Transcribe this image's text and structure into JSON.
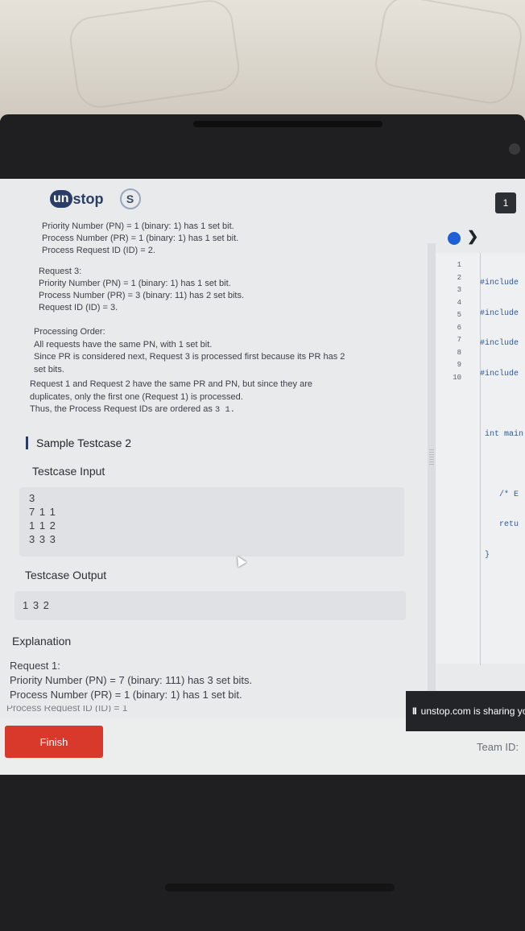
{
  "header": {
    "logo_un": "un",
    "logo_stop": "stop",
    "badge_glyph": "S",
    "question_number": "1"
  },
  "problem": {
    "req2_lines": [
      "Priority Number (PN) = 1 (binary: 1) has 1 set bit.",
      "Process Number (PR) = 1 (binary: 1) has 1 set bit.",
      "Process Request ID (ID) = 2."
    ],
    "req3_title": "Request 3:",
    "req3_lines": [
      "Priority Number (PN) = 1 (binary: 1) has 1 set bit.",
      "Process Number (PR) = 3 (binary: 11) has 2 set bits.",
      "Request ID (ID) = 3."
    ],
    "order_title": "Processing Order:",
    "order_lines": [
      "All requests have the same PN, with 1 set bit.",
      "Since PR is considered next, Request 3 is processed first because its PR has 2",
      "set bits.",
      "Request 1 and Request 2 have the same PR and PN, but since they are",
      "duplicates, only the first one (Request 1) is processed."
    ],
    "order_final_prefix": "Thus, the Process Request IDs are ordered as",
    "order_final_code": "3 1."
  },
  "testcase2": {
    "heading": "Sample Testcase 2",
    "input_label": "Testcase Input",
    "input_lines": [
      "3",
      "7 1 1",
      "1 1 2",
      "3 3 3"
    ],
    "output_label": "Testcase Output",
    "output_value": "1 3 2",
    "explanation_label": "Explanation",
    "exp_req1_title": "Request 1:",
    "exp_lines": [
      "Priority Number (PN) = 7 (binary: 111) has 3 set bits.",
      "Process Number (PR) = 1 (binary: 1) has 1 set bit."
    ],
    "exp_partial": "Process Request ID (ID) = 1"
  },
  "editor": {
    "line_numbers": [
      "1",
      "2",
      "3",
      "4",
      "5",
      "6",
      "7",
      "8",
      "9",
      "10"
    ],
    "code_lines": [
      "#include",
      "#include",
      "#include",
      "#include",
      "",
      " int main",
      "",
      "    /* E",
      "    retu",
      " }"
    ],
    "accent": "#1e5fd6"
  },
  "footer": {
    "finish_label": "Finish",
    "share_text": "unstop.com is sharing yo",
    "share_pause": "II",
    "team_label": "Team ID:"
  }
}
